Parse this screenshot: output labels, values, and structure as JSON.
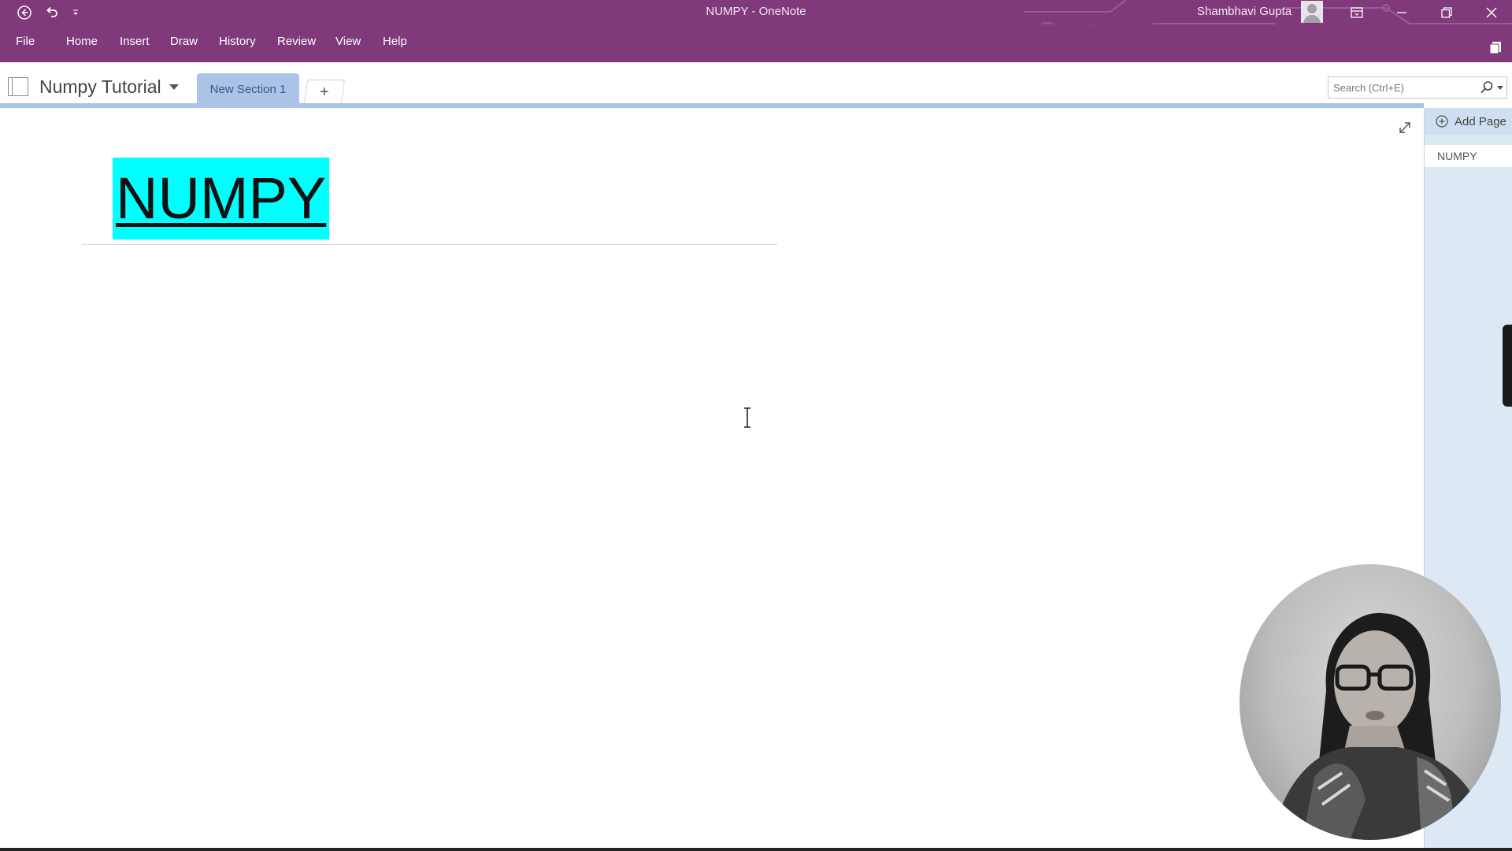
{
  "window": {
    "title": "NUMPY  -  OneNote",
    "user_name": "Shambhavi Gupta"
  },
  "menu": {
    "items": [
      "File",
      "Home",
      "Insert",
      "Draw",
      "History",
      "Review",
      "View",
      "Help"
    ]
  },
  "notebook": {
    "name": "Numpy Tutorial",
    "section_tab": "New Section 1",
    "add_section": "+"
  },
  "search": {
    "placeholder": "Search (Ctrl+E)",
    "value": ""
  },
  "page": {
    "title": "NUMPY"
  },
  "page_list": {
    "add_page_label": "Add Page",
    "pages": [
      "NUMPY"
    ]
  },
  "colors": {
    "brand_purple": "#80397b",
    "section_blue": "#a9c4e4",
    "title_highlight": "#00ffff",
    "page_pane_bg": "#dde8f5"
  },
  "icons": {
    "back": "back-arrow-icon",
    "undo": "undo-icon",
    "customize": "qat-dropdown-icon",
    "ribbon_display": "ribbon-display-icon",
    "minimize": "minimize-icon",
    "restore": "restore-icon",
    "close": "close-icon",
    "search": "search-icon",
    "expand": "expand-icon",
    "add_page": "plus-circle-icon"
  }
}
